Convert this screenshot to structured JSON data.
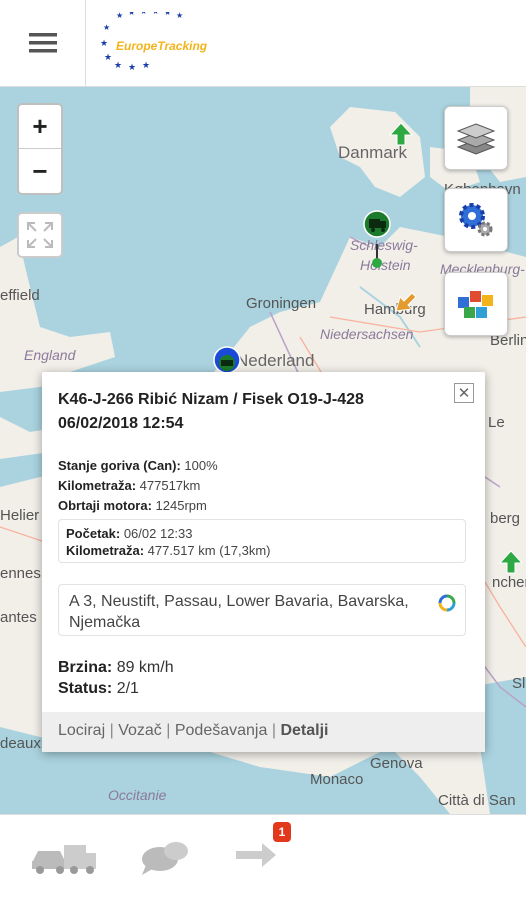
{
  "header": {
    "menu_icon": "hamburger-menu-icon",
    "logo_text": "EuropeTracking"
  },
  "map": {
    "zoom_in": "+",
    "zoom_out": "−",
    "labels": {
      "danmark": "Danmark",
      "kobenhavn": "København",
      "schleswig": "Schleswig-",
      "holstein": "Holstein",
      "mecklenburg": "Mecklenburg-",
      "sheffield": "effield",
      "groningen": "Groningen",
      "hamburg": "Hamburg",
      "england": "England",
      "niedersachsen": "Niedersachsen",
      "berlin": "Berlin",
      "nederland": "Nederland",
      "lei": "Le",
      "helier": "Helier",
      "ennes": "ennes",
      "antes": "antes",
      "deaux": "deaux",
      "berg": "berg",
      "nchen": "nchen",
      "sl": "Sl",
      "monaco": "Monaco",
      "genova": "Genova",
      "occitanie": "Occitanie",
      "citta": "Città di San"
    }
  },
  "popup": {
    "title": "K46-J-266 Ribić Nizam / Fisek O19-J-428 06/02/2018 12:54",
    "close": "✕",
    "fuel_label": "Stanje goriva (Can):",
    "fuel_value": "100%",
    "km_label": "Kilometraža:",
    "km_value": "477517km",
    "rpm_label": "Obrtaji motora:",
    "rpm_value": "1245rpm",
    "start_label": "Početak:",
    "start_value": "06/02 12:33",
    "km2_label": "Kilometraža:",
    "km2_value": "477.517 km (17,3km)",
    "address": "A 3, Neustift, Passau, Lower Bavaria, Bavarska, Njemačka",
    "speed_label": "Brzina:",
    "speed_value": "89 km/h",
    "status_label": "Status:",
    "status_value": "2/1",
    "footer": {
      "locate": "Lociraj",
      "driver": "Vozač",
      "settings": "Podešavanja",
      "details": "Detalji",
      "sep": "|"
    }
  },
  "bottom_nav": {
    "badge": "1"
  },
  "colors": {
    "sea": "#aad3df",
    "land": "#f2efe9",
    "badge": "#e2381c",
    "marker_green": "#2da842",
    "marker_orange": "#e39a2e"
  }
}
